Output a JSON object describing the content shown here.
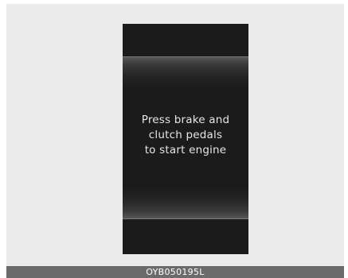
{
  "display": {
    "message_lines": [
      "Press brake and",
      "clutch pedals",
      "to start engine"
    ]
  },
  "caption": {
    "code": "OYB050195L"
  },
  "colors": {
    "background": "#ebebeb",
    "display": "#1b1b1b",
    "text": "#e6e6e6",
    "caption_bar": "#6b6b6b"
  }
}
